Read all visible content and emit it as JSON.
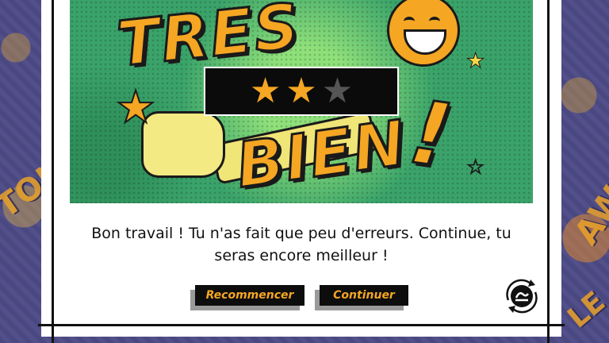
{
  "background": {
    "text_left": "TOU",
    "text_right": "AWE",
    "text_right_bottom": "LE"
  },
  "illustration": {
    "word_top": "TRES",
    "word_bottom": "BIEN",
    "exclamation": "!"
  },
  "rating": {
    "filled_stars": 2,
    "total_stars": 3,
    "filled_color": "#f5a623",
    "empty_color": "#555555",
    "stars": [
      "★",
      "★",
      "★"
    ]
  },
  "message": "Bon travail ! Tu n'as fait que peu d'erreurs. Continue, tu seras encore meilleur !",
  "buttons": {
    "restart_label": "Recommencer",
    "continue_label": "Continuer"
  },
  "icons": {
    "reload": "reload-icon"
  }
}
